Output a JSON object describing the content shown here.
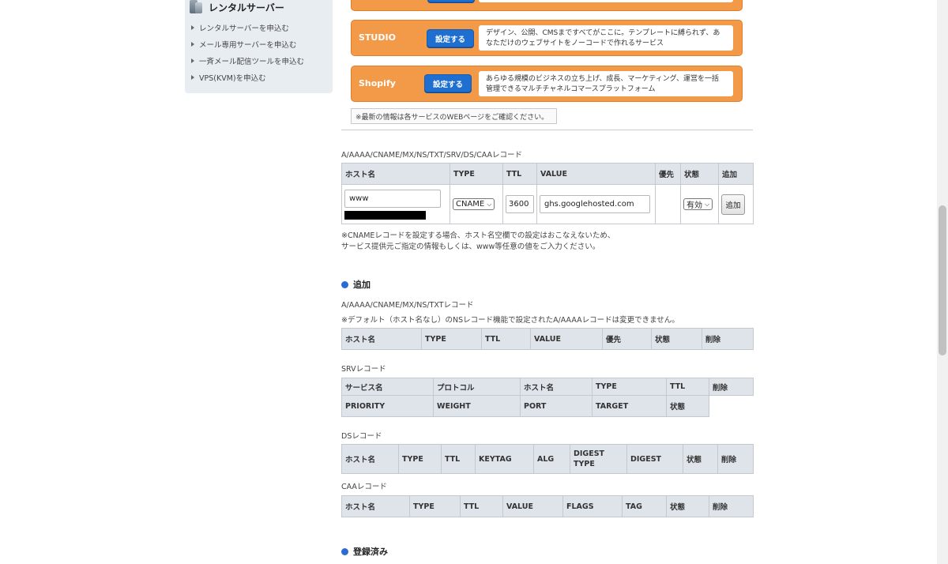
{
  "sidebar": {
    "title": "レンタルサーバー",
    "items": [
      {
        "label": "レンタルサーバーを申込む"
      },
      {
        "label": "メール専用サーバーを申込む"
      },
      {
        "label": "一斉メール配信ツールを申込む"
      },
      {
        "label": "VPS(KVM)を申込む"
      }
    ]
  },
  "services": [
    {
      "name": "STUDIO",
      "button": "設定する",
      "description": "デザイン、公開、CMSまですべてがここに。テンプレートに縛られず、あなただけのウェブサイトをノーコードで作れるサービス"
    },
    {
      "name": "Shopify",
      "button": "設定する",
      "description": "あらゆる規模のビジネスの立ち上げ、成長、マーケティング、運営を一括管理できるマルチチャネルコマースプラットフォーム"
    }
  ],
  "notice": "※最新の情報は各サービスのWEBページをご確認ください。",
  "record_form": {
    "label": "A/AAAA/CNAME/MX/NS/TXT/SRV/DS/CAAレコード",
    "headers": [
      "ホスト名",
      "TYPE",
      "TTL",
      "VALUE",
      "優先",
      "状態",
      "追加"
    ],
    "host": "www",
    "type": "CNAME",
    "ttl": "3600",
    "value": "ghs.googlehosted.com",
    "status": "有効",
    "add_button": "追加",
    "note_line1": "※CNAMEレコードを設定する場合、ホスト名空欄での設定はおこなえないため、",
    "note_line2": "サービス提供元ご指定の情報もしくは、www等任意の値をご入力ください。"
  },
  "add_section": {
    "heading": "追加",
    "general_label": "A/AAAA/CNAME/MX/NS/TXTレコード",
    "general_note": "※デフォルト（ホスト名なし）のNSレコード機能で設定されたA/AAAAレコードは変更できません。",
    "general_headers": [
      "ホスト名",
      "TYPE",
      "TTL",
      "VALUE",
      "優先",
      "状態",
      "削除"
    ],
    "srv_label": "SRVレコード",
    "srv_headers_row1": [
      "サービス名",
      "プロトコル",
      "ホスト名",
      "TYPE",
      "TTL",
      "削除"
    ],
    "srv_headers_row2": [
      "PRIORITY",
      "WEIGHT",
      "PORT",
      "TARGET",
      "状態"
    ],
    "ds_label": "DSレコード",
    "ds_headers": [
      "ホスト名",
      "TYPE",
      "TTL",
      "KEYTAG",
      "ALG",
      "DIGEST TYPE",
      "DIGEST",
      "状態",
      "削除"
    ],
    "caa_label": "CAAレコード",
    "caa_headers": [
      "ホスト名",
      "TYPE",
      "TTL",
      "VALUE",
      "FLAGS",
      "TAG",
      "状態",
      "削除"
    ]
  },
  "registered_section": {
    "heading": "登録済み"
  }
}
